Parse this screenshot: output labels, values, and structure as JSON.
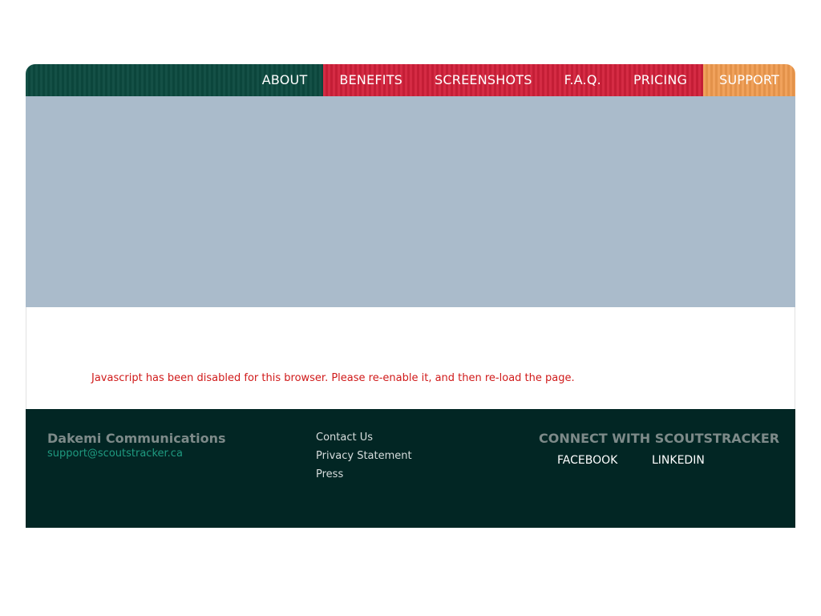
{
  "nav": {
    "items": [
      {
        "label": "ABOUT"
      },
      {
        "label": "BENEFITS"
      },
      {
        "label": "SCREENSHOTS"
      },
      {
        "label": "F.A.Q."
      },
      {
        "label": "PRICING"
      },
      {
        "label": "SUPPORT"
      }
    ]
  },
  "content": {
    "js_warning": "Javascript has been disabled for this browser. Please re-enable it, and then re-load the page."
  },
  "footer": {
    "company_name": "Dakemi Communications",
    "email": "support@scoutstracker.ca",
    "links": [
      "Contact Us",
      "Privacy Statement",
      "Press"
    ],
    "connect_title": "CONNECT WITH SCOUTSTRACKER",
    "social": {
      "facebook": "FACEBOOK",
      "linkedin": "LINKEDIN"
    }
  },
  "colors": {
    "nav_green": "#0c4a3f",
    "nav_red": "#d3203a",
    "nav_orange": "#ef9a4e",
    "hero_bg": "#aabbcb",
    "footer_bg": "#022624",
    "warning_text": "#d01a1a",
    "email_link": "#1f9a80"
  }
}
